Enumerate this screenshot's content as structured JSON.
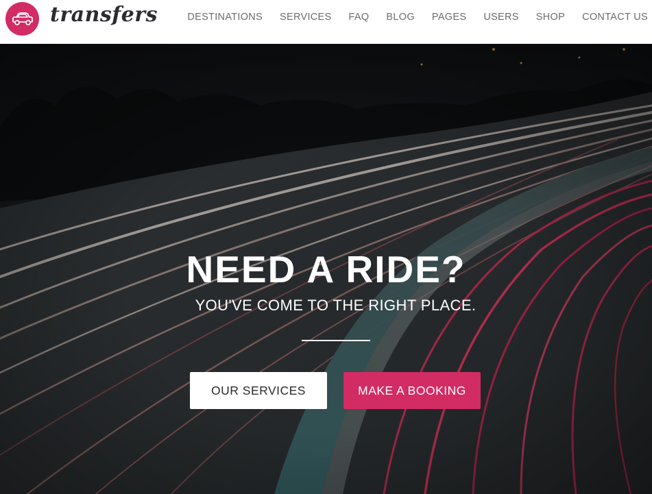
{
  "brand": {
    "logo_text": "transfers",
    "accent_color": "#d32b63",
    "icon": "car-icon"
  },
  "nav": {
    "items": [
      {
        "label": "DESTINATIONS"
      },
      {
        "label": "SERVICES"
      },
      {
        "label": "FAQ"
      },
      {
        "label": "BLOG"
      },
      {
        "label": "PAGES"
      },
      {
        "label": "USERS"
      },
      {
        "label": "SHOP"
      },
      {
        "label": "CONTACT US"
      }
    ]
  },
  "hero": {
    "title": "NEED A RIDE?",
    "subtitle": "YOU'VE COME TO THE RIGHT PLACE.",
    "background": "night highway with light trails",
    "buttons": {
      "services_label": "OUR SERVICES",
      "booking_label": "MAKE A BOOKING"
    }
  }
}
